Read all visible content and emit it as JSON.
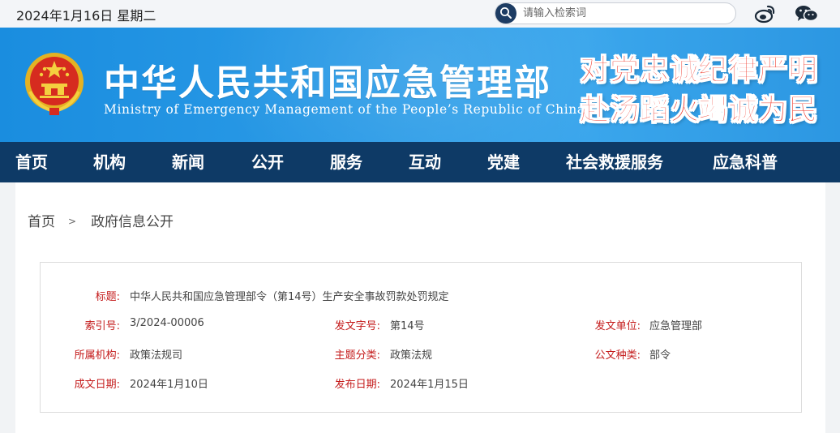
{
  "topbar": {
    "date": "2024年1月16日 星期二",
    "search_placeholder": "请输入检索词",
    "search_icon": "search-icon",
    "social": [
      "weibo-icon",
      "wechat-icon"
    ]
  },
  "header": {
    "title": "中华人民共和国应急管理部",
    "subtitle": "Ministry of Emergency Management of the People’s Republic of China",
    "slogans": [
      "对党忠诚",
      "纪律严明",
      "赴汤蹈火",
      "竭诚为民"
    ],
    "colors": {
      "banner": "#2a9ae6",
      "slogan": "#ee2a1b"
    }
  },
  "nav": {
    "items": [
      "首页",
      "机构",
      "新闻",
      "公开",
      "服务",
      "互动",
      "党建",
      "社会救援服务",
      "应急科普"
    ],
    "color": "#0e3a66"
  },
  "breadcrumb": {
    "home": "首页",
    "separator": ">",
    "current": "政府信息公开"
  },
  "document": {
    "title_label": "标题:",
    "title_value": "中华人民共和国应急管理部令（第14号）生产安全事故罚款处罚规定",
    "index_label": "索引号:",
    "index_value": "3/2024-00006",
    "doc_no_label": "发文字号:",
    "doc_no_value": "第14号",
    "issuer_label": "发文单位:",
    "issuer_value": "应急管理部",
    "org_label": "所属机构:",
    "org_value": "政策法规司",
    "topic_label": "主题分类:",
    "topic_value": "政策法规",
    "type_label": "公文种类:",
    "type_value": "部令",
    "written_label": "成文日期:",
    "written_value": "2024年1月10日",
    "published_label": "发布日期:",
    "published_value": "2024年1月15日",
    "label_color": "#c41a1a"
  }
}
